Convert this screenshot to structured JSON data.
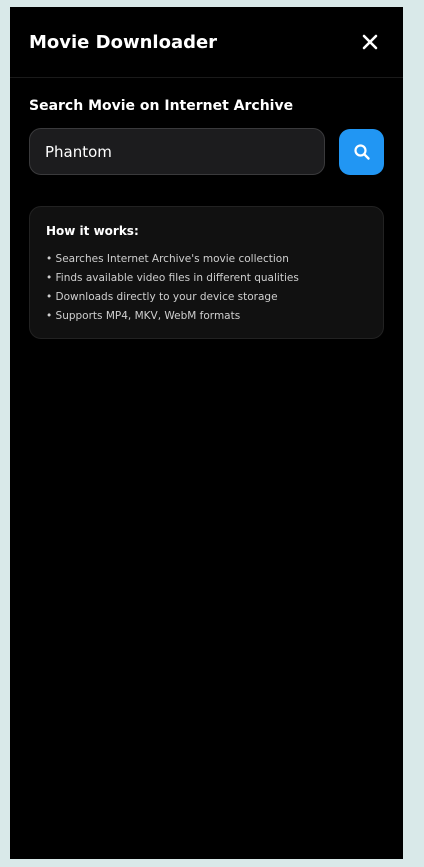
{
  "header": {
    "title": "Movie Downloader",
    "close_icon": "close-icon"
  },
  "search": {
    "label": "Search Movie on Internet Archive",
    "value": "Phantom",
    "button_icon": "search-icon",
    "accent_color": "#2196f3"
  },
  "info": {
    "title": "How it works:",
    "items": [
      "• Searches Internet Archive's movie collection",
      "• Finds available video files in different qualities",
      "• Downloads directly to your device storage",
      "• Supports MP4, MKV, WebM formats"
    ]
  }
}
